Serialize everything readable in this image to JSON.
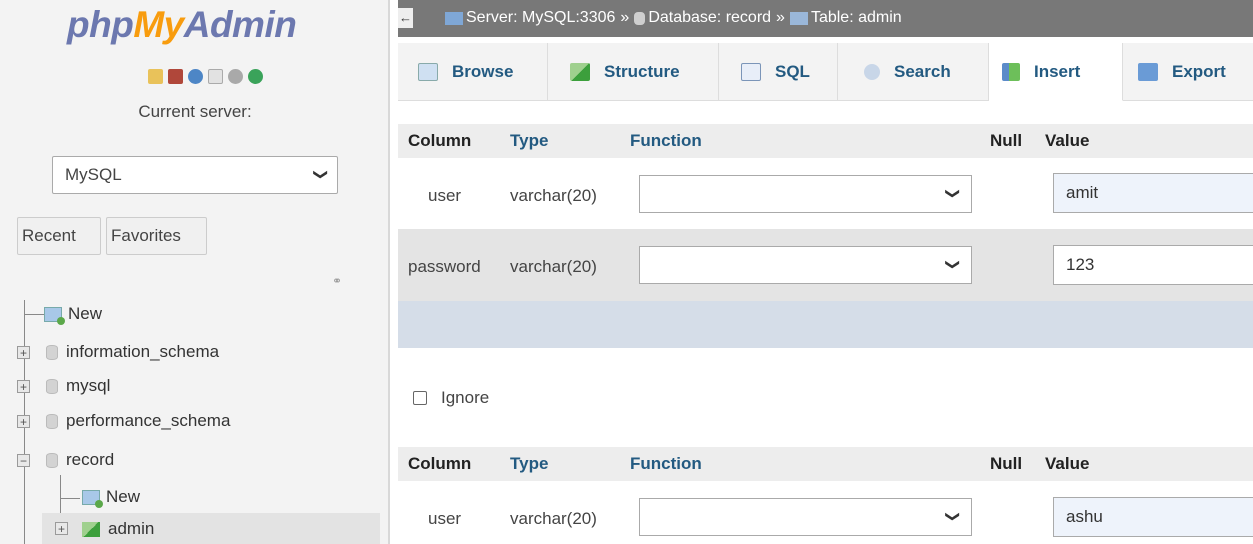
{
  "nav": {
    "logo": {
      "php": "php",
      "my": "My",
      "admin": "Admin"
    },
    "logo_icons": [
      "home-icon",
      "database-icon",
      "help-icon",
      "docs-icon",
      "settings-icon",
      "reload-icon"
    ],
    "current_server_label": "Current server:",
    "server_select_value": "MySQL",
    "recent_label": "Recent",
    "favorites_label": "Favorites",
    "tree": {
      "new": "New",
      "databases": [
        "information_schema",
        "mysql",
        "performance_schema",
        "record"
      ],
      "record_children": {
        "new": "New",
        "admin": "admin"
      }
    }
  },
  "topbar": {
    "server": "Server: MySQL:3306",
    "database": "Database: record",
    "table": "Table: admin",
    "sep": "»"
  },
  "tabs": [
    {
      "label": "Browse",
      "icon": "browse-icon"
    },
    {
      "label": "Structure",
      "icon": "structure-icon"
    },
    {
      "label": "SQL",
      "icon": "sql-icon"
    },
    {
      "label": "Search",
      "icon": "search-icon"
    },
    {
      "label": "Insert",
      "icon": "insert-icon",
      "active": true
    },
    {
      "label": "Export",
      "icon": "export-icon"
    }
  ],
  "form": {
    "headers": {
      "column": "Column",
      "type": "Type",
      "function": "Function",
      "null": "Null",
      "value": "Value"
    },
    "row1": {
      "column": "user",
      "type": "varchar(20)",
      "value": "amit"
    },
    "row2": {
      "column": "password",
      "type": "varchar(20)",
      "value": "123"
    },
    "ignore_label": "Ignore",
    "row3": {
      "column": "user",
      "type": "varchar(20)",
      "value": "ashu"
    }
  }
}
